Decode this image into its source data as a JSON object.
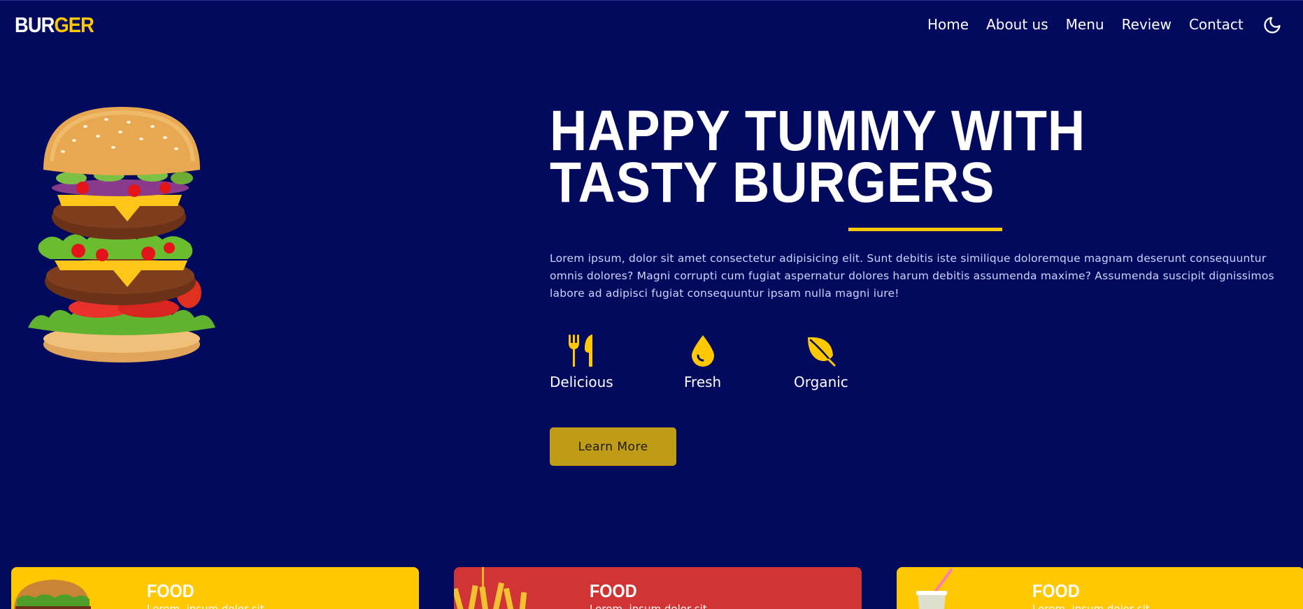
{
  "logo": {
    "part1": "BUR",
    "part2": "GER"
  },
  "nav": {
    "items": [
      "Home",
      "About us",
      "Menu",
      "Review",
      "Contact"
    ],
    "theme_icon": "moon-icon"
  },
  "hero": {
    "title": "HAPPY TUMMY WITH TASTY BURGERS",
    "description": "Lorem ipsum, dolor sit amet consectetur adipisicing elit. Sunt debitis iste similique doloremque magnam deserunt consequuntur omnis dolores? Magni corrupti cum fugiat aspernatur dolores harum debitis assumenda maxime? Assumenda suscipit dignissimos labore ad adipisci fugiat consequuntur ipsam nulla magni iure!",
    "features": [
      {
        "label": "Delicious",
        "icon": "utensils-icon"
      },
      {
        "label": "Fresh",
        "icon": "droplet-icon"
      },
      {
        "label": "Organic",
        "icon": "leaf-icon"
      }
    ],
    "button_label": "Learn More"
  },
  "cards": [
    {
      "title": "FOOD",
      "subtitle": "Lorem, ipsum dolor sit",
      "color": "#ffc800"
    },
    {
      "title": "FOOD",
      "subtitle": "Lorem, ipsum dolor sit",
      "color": "#d03434"
    },
    {
      "title": "FOOD",
      "subtitle": "Lorem, ipsum dolor sit",
      "color": "#ffc800"
    }
  ],
  "colors": {
    "background": "#020a5e",
    "accent": "#ffc800",
    "button": "#bf9b16"
  }
}
